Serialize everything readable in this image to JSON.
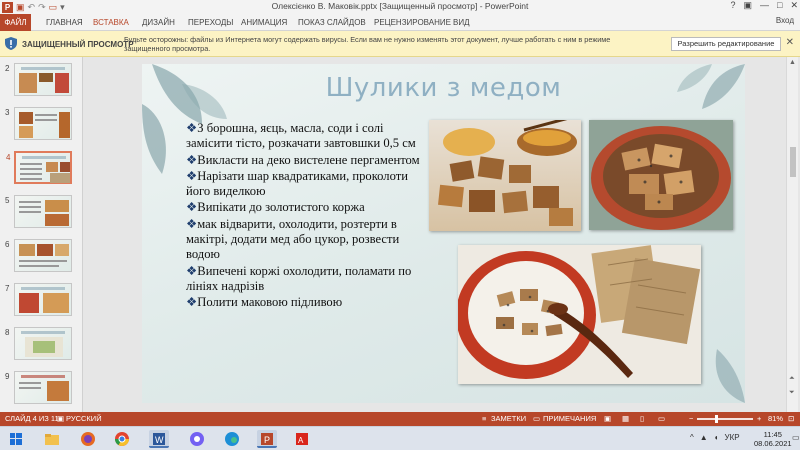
{
  "window": {
    "title": "Олексієнко В. Маковік.pptx [Защищенный просмотр] - PowerPoint",
    "help": "?",
    "controls": [
      "—",
      "□",
      "✕"
    ]
  },
  "quick_access": [
    "save",
    "undo",
    "redo",
    "slideshow"
  ],
  "ribbon": {
    "tabs": [
      {
        "label": "ФАЙЛ"
      },
      {
        "label": "ГЛАВНАЯ"
      },
      {
        "label": "ВСТАВКА"
      },
      {
        "label": "ДИЗАЙН"
      },
      {
        "label": "ПЕРЕХОДЫ"
      },
      {
        "label": "АНИМАЦИЯ"
      },
      {
        "label": "ПОКАЗ СЛАЙДОВ"
      },
      {
        "label": "РЕЦЕНЗИРОВАНИЕ"
      },
      {
        "label": "ВИД"
      }
    ],
    "active_tab": "ВСТАВКА",
    "signin": "Вход"
  },
  "protected_view": {
    "label": "ЗАЩИЩЕННЫЙ ПРОСМОТР",
    "message": "Будьте осторожны: файлы из Интернета могут содержать вирусы. Если вам не нужно изменять этот документ, лучше работать с ним в режиме защищенного просмотра.",
    "button": "Разрешить редактирование",
    "close": "✕"
  },
  "thumbnails": [
    {
      "num": "2"
    },
    {
      "num": "3"
    },
    {
      "num": "4",
      "selected": true
    },
    {
      "num": "5"
    },
    {
      "num": "6"
    },
    {
      "num": "7"
    },
    {
      "num": "8"
    },
    {
      "num": "9"
    }
  ],
  "slide": {
    "title": "Шулики з медом",
    "bullets": [
      {
        "marker": "❖",
        "text": "З борошна, яєць, масла, соди і солі замісити тісто, розкачати завтовшки 0,5 см"
      },
      {
        "marker": "❖",
        "text": "Викласти на деко вистелене пергаментом"
      },
      {
        "marker": "❖",
        "text": "Нарізати шар квадратиками, проколоти його виделкою"
      },
      {
        "marker": "❖",
        "text": "Випікати до золотистого коржа"
      },
      {
        "marker": "❖",
        "text": "мак відварити, охолодити, розтерти в макітрі, додати мед або цукор, розвести водою"
      },
      {
        "marker": "❖",
        "text": "Випечені коржі охолодити, поламати по лініях надрізів"
      },
      {
        "marker": "❖",
        "text": "Полити маковою підливою"
      }
    ]
  },
  "status": {
    "slide_info": "СЛАЙД 4 ИЗ 11",
    "language": "РУССКИЙ",
    "notes": "ЗАМЕТКИ",
    "comments": "ПРИМЕЧАНИЯ",
    "zoom_minus": "−",
    "zoom_plus": "+",
    "zoom": "81%"
  },
  "taskbar": {
    "time": "11:45",
    "date": "08.06.2021",
    "language": "УКР"
  },
  "colors": {
    "accent": "#b7472a",
    "title_blue": "#8fb0c3",
    "bullet_marker": "#1e3d6d"
  }
}
